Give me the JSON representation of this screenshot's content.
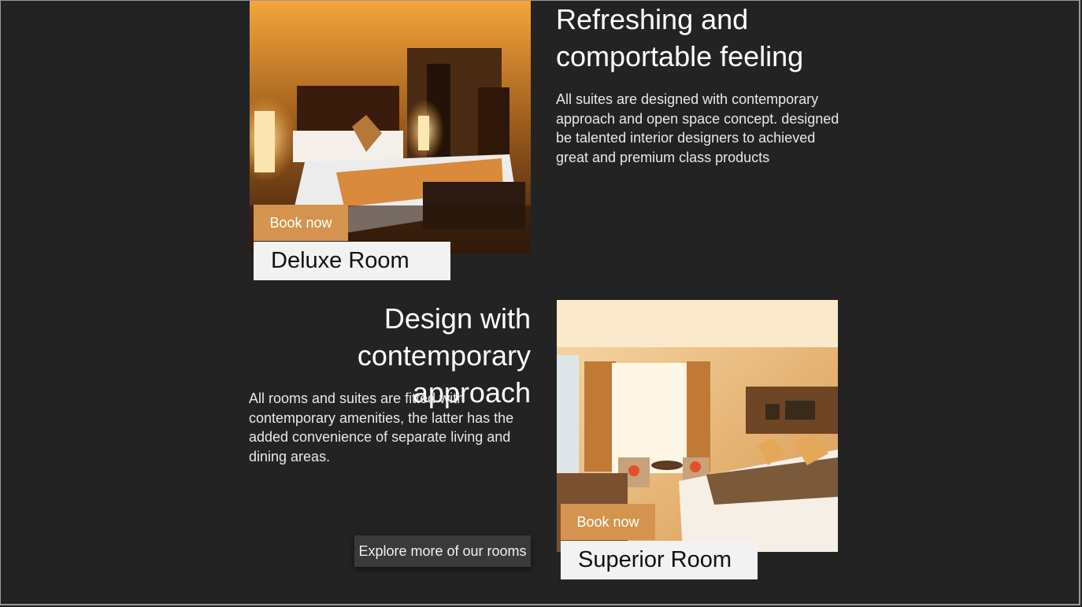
{
  "rooms": [
    {
      "name": "Deluxe Room",
      "book_label": "Book now",
      "heading": "Refreshing and comportable feeling",
      "description": "All suites are designed with contemporary approach and open space concept. designed be talented interior designers to achieved great and premium class products"
    },
    {
      "name": "Superior Room",
      "book_label": "Book now",
      "heading": "Design with contemporary approach",
      "description": "All rooms and suites are fitted with contemporary amenities, the latter has the added convenience of separate living and dining areas."
    }
  ],
  "explore_label": "Explore more of our rooms",
  "colors": {
    "background": "#232323",
    "book_button": "#d4944f",
    "name_box": "#f2f2f2",
    "explore_button": "#3a3a3a"
  }
}
